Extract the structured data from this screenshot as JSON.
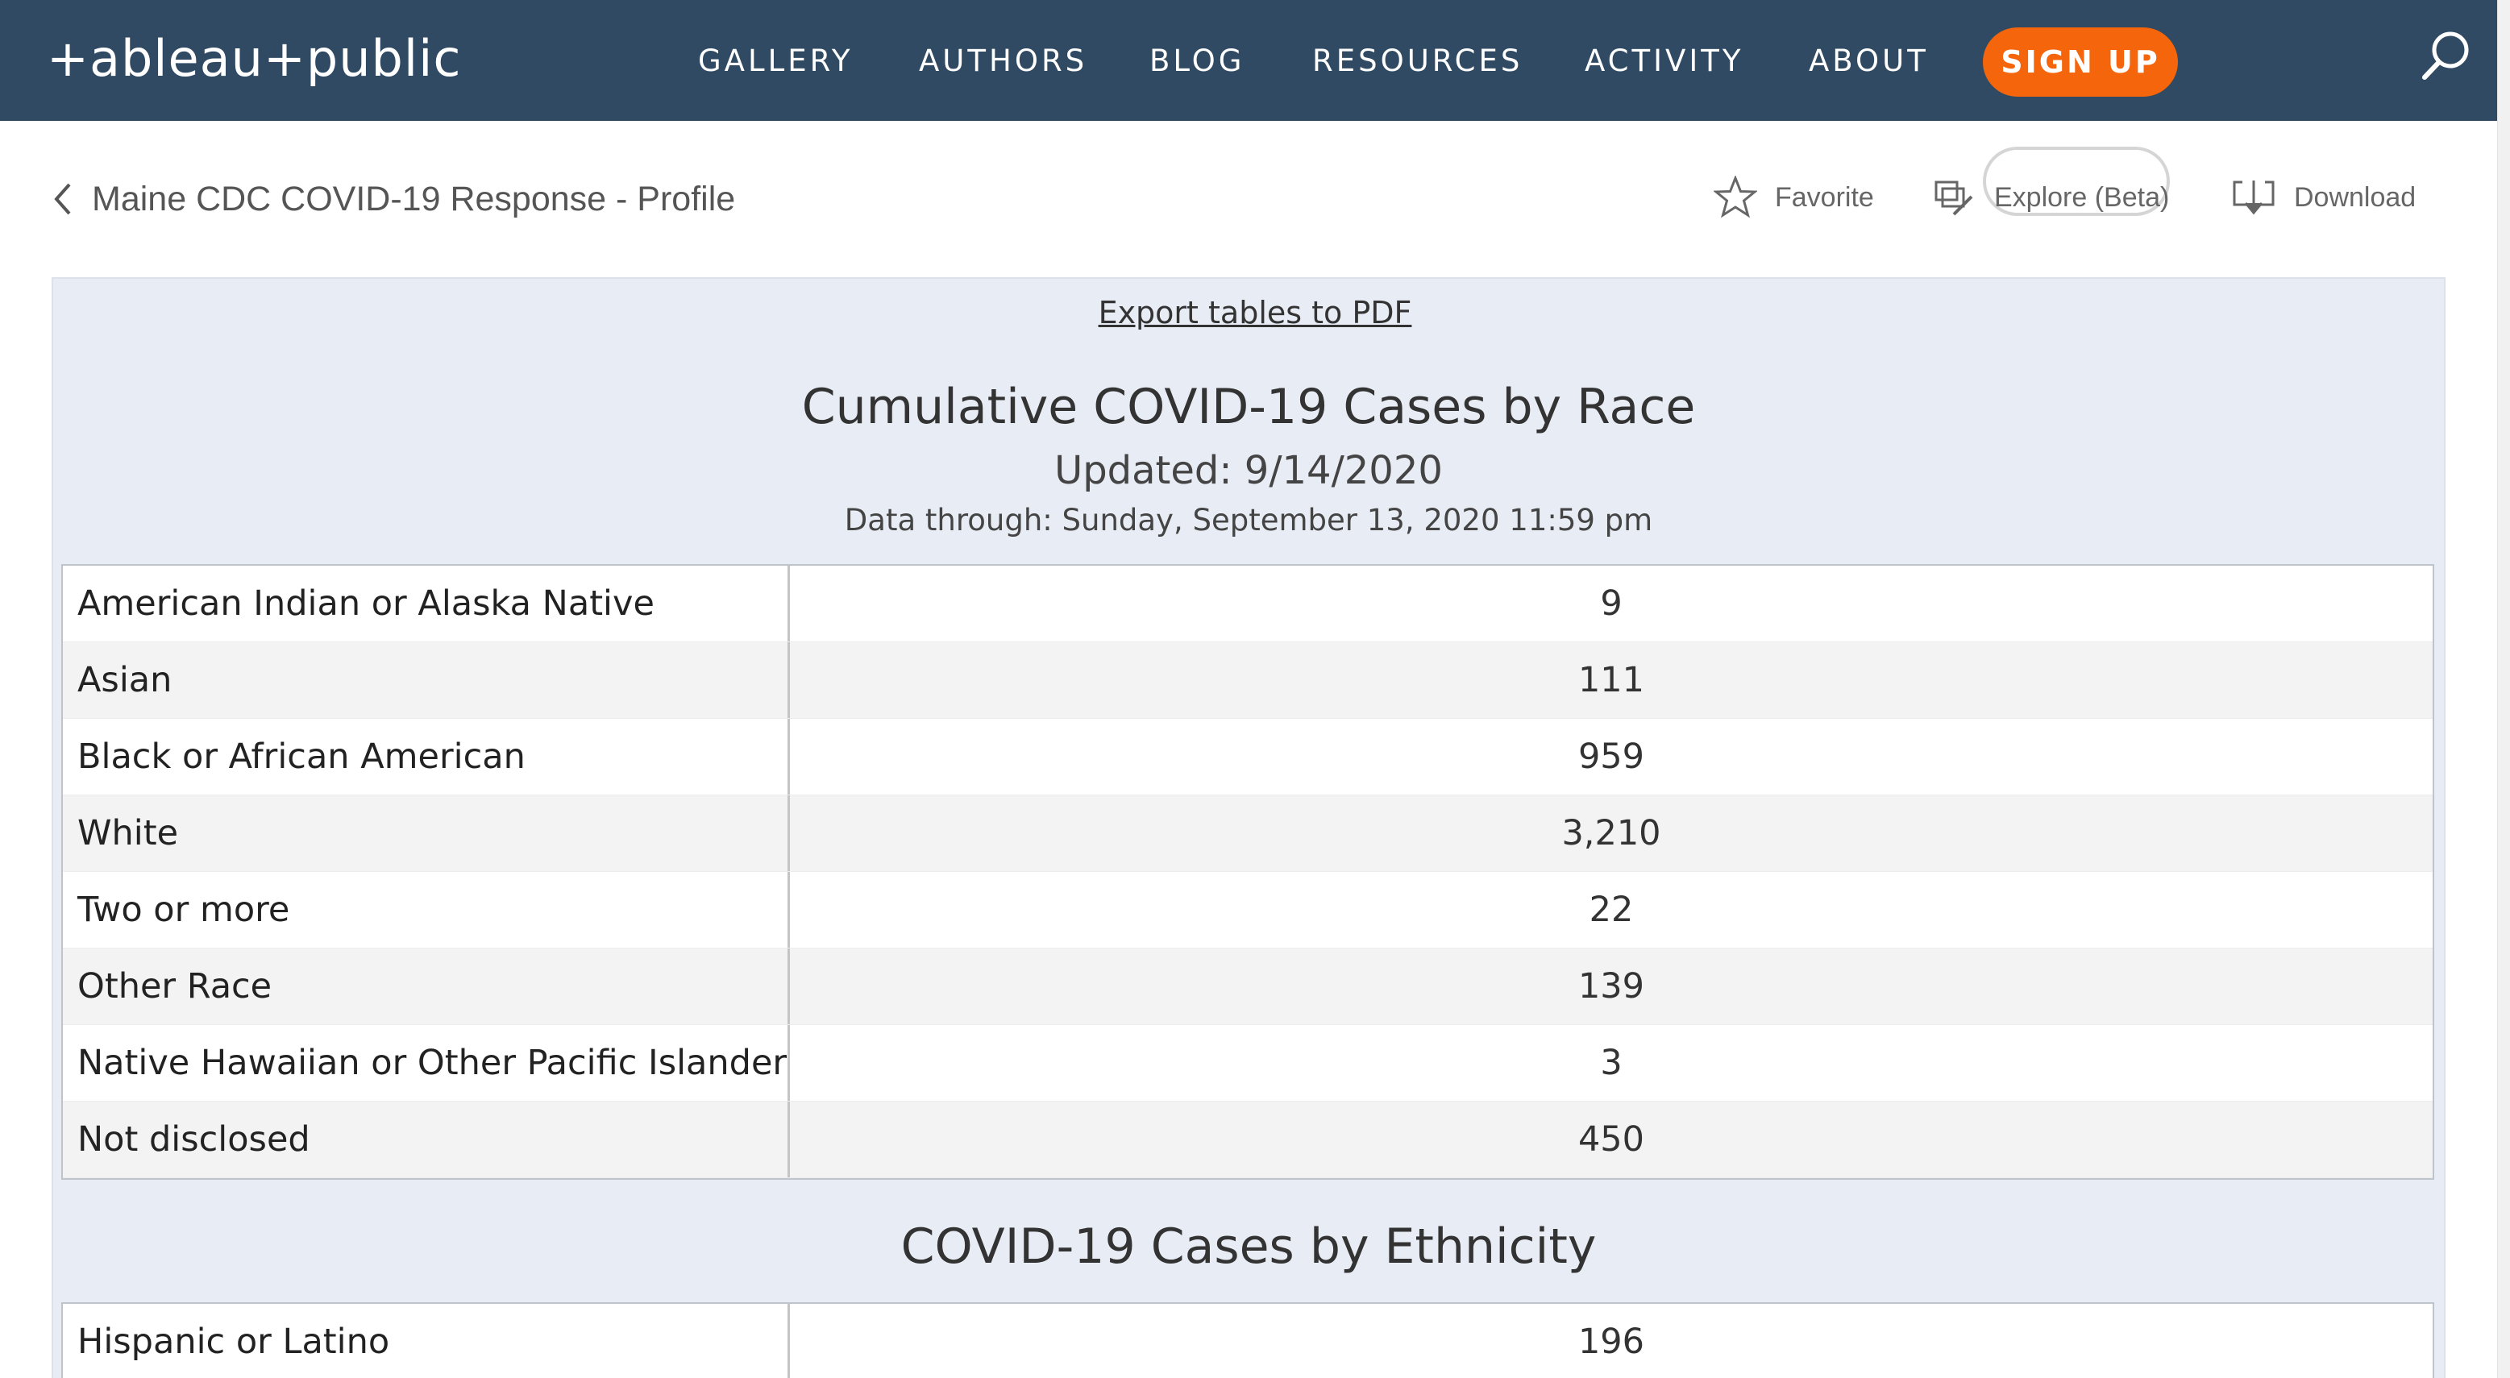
{
  "brand": {
    "name": "+ableau+public"
  },
  "nav": {
    "items": [
      {
        "label": "GALLERY"
      },
      {
        "label": "AUTHORS"
      },
      {
        "label": "BLOG"
      },
      {
        "label": "RESOURCES"
      },
      {
        "label": "ACTIVITY"
      },
      {
        "label": "ABOUT"
      }
    ],
    "signup_label": "SIGN UP",
    "search_icon": "search-icon"
  },
  "subbar": {
    "back_label": "Maine CDC COVID-19 Response - Profile",
    "favorite_label": "Favorite",
    "explore_label": "Explore (Beta)",
    "download_label": "Download"
  },
  "dashboard": {
    "export_label": "Export tables to PDF",
    "race_title": "Cumulative COVID-19 Cases by Race",
    "updated": "Updated: 9/14/2020",
    "data_through": "Data through: Sunday, September 13, 2020 11:59 pm",
    "race_rows": [
      {
        "label": "American Indian or Alaska Native",
        "value": "9"
      },
      {
        "label": "Asian",
        "value": "111"
      },
      {
        "label": "Black or African American",
        "value": "959"
      },
      {
        "label": "White",
        "value": "3,210"
      },
      {
        "label": "Two or more",
        "value": "22"
      },
      {
        "label": "Other Race",
        "value": "139"
      },
      {
        "label": "Native Hawaiian or Other Pacific Islander",
        "value": "3"
      },
      {
        "label": "Not disclosed",
        "value": "450"
      }
    ],
    "ethnicity_title": "COVID-19 Cases by Ethnicity",
    "ethnicity_rows": [
      {
        "label": "Hispanic or Latino",
        "value": "196"
      }
    ]
  },
  "colors": {
    "nav_bg": "#2f4a62",
    "signup_bg": "#f4650c",
    "panel_bg": "#e8ecf4"
  }
}
